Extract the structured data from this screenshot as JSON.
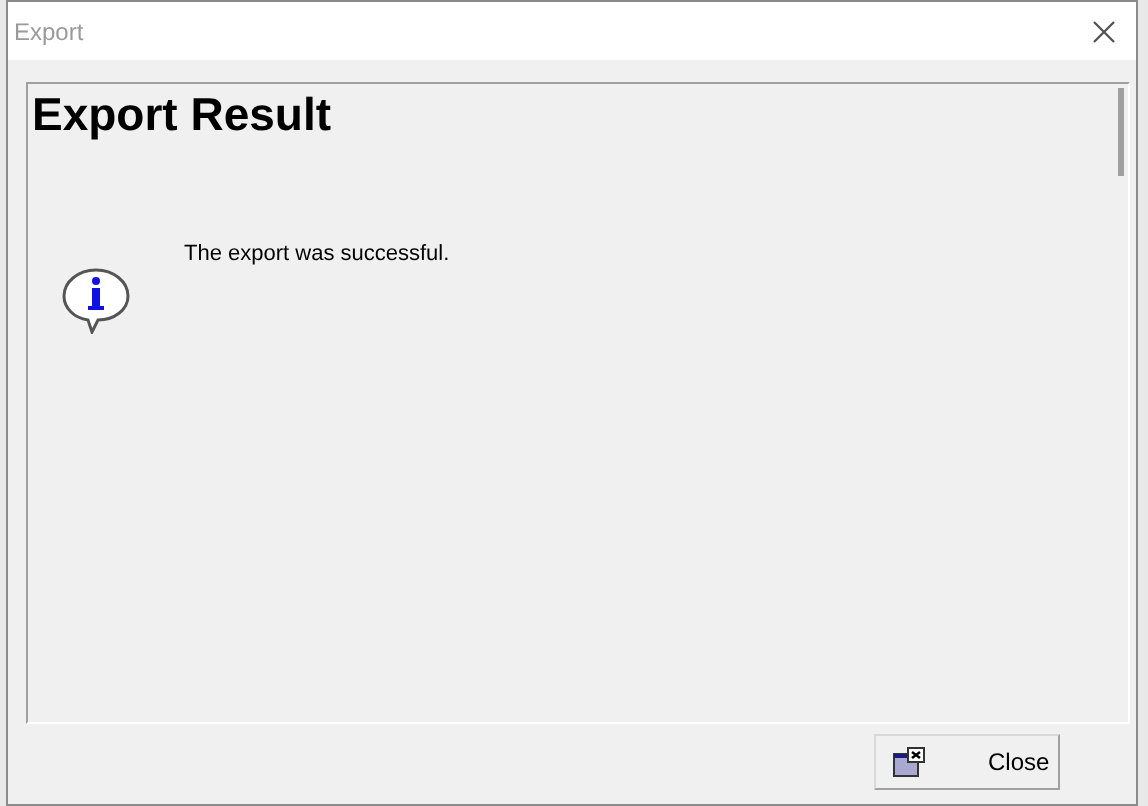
{
  "window": {
    "title": "Export"
  },
  "panel": {
    "heading": "Export Result",
    "message": "The export was successful."
  },
  "buttons": [
    {
      "label": "Close"
    }
  ]
}
